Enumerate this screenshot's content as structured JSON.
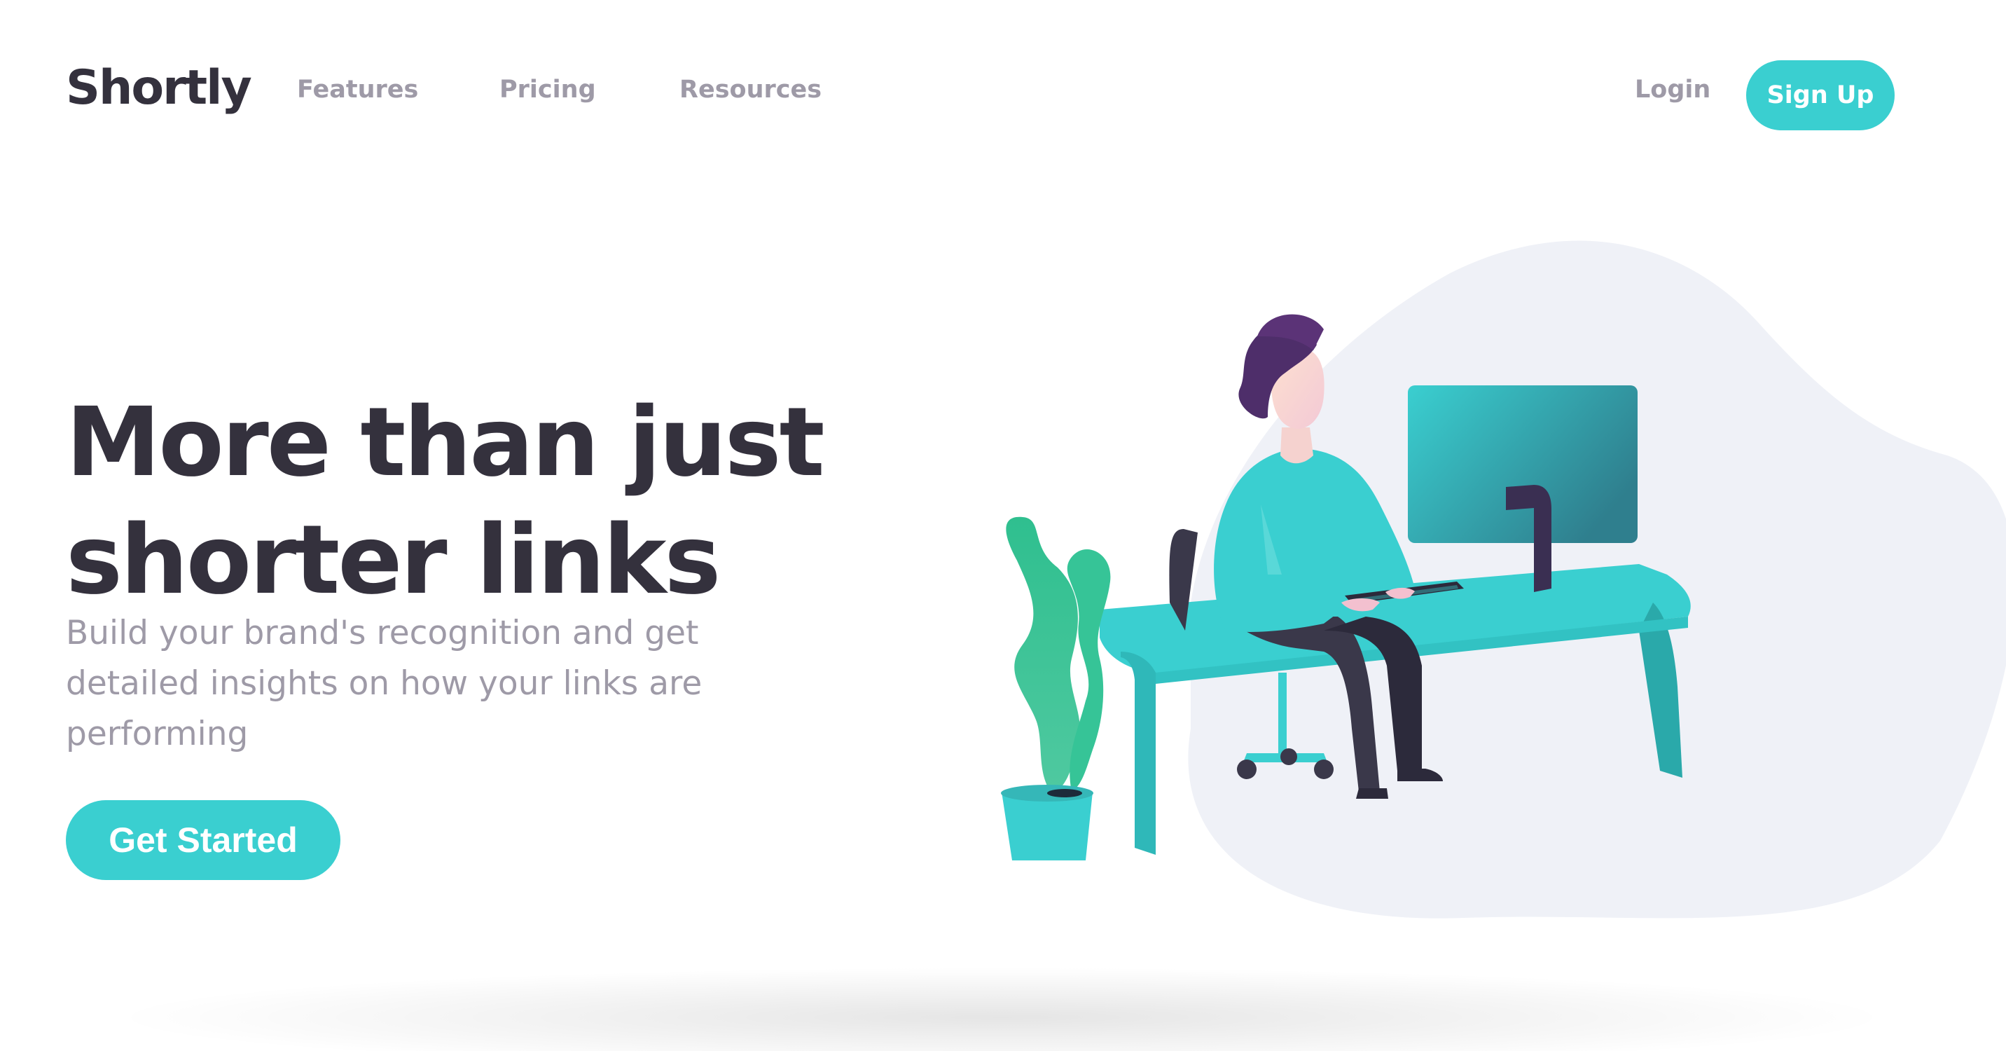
{
  "theme": {
    "accent": "#3acfd0",
    "dark": "#34313d",
    "gray": "#9e9aa7",
    "blob": "#eff1f7"
  },
  "nav": {
    "logo": "Shortly",
    "links": [
      {
        "label": "Features"
      },
      {
        "label": "Pricing"
      },
      {
        "label": "Resources"
      }
    ],
    "login": "Login",
    "signup": "Sign Up"
  },
  "hero": {
    "title_line1": "More than just",
    "title_line2": "shorter links",
    "subtitle_line1": "Build your brand's recognition and get",
    "subtitle_line2": "detailed insights on how your links are",
    "subtitle_line3": "performing",
    "cta": "Get Started"
  },
  "illustration": {
    "icon": "person-working-at-desk-illustration"
  }
}
